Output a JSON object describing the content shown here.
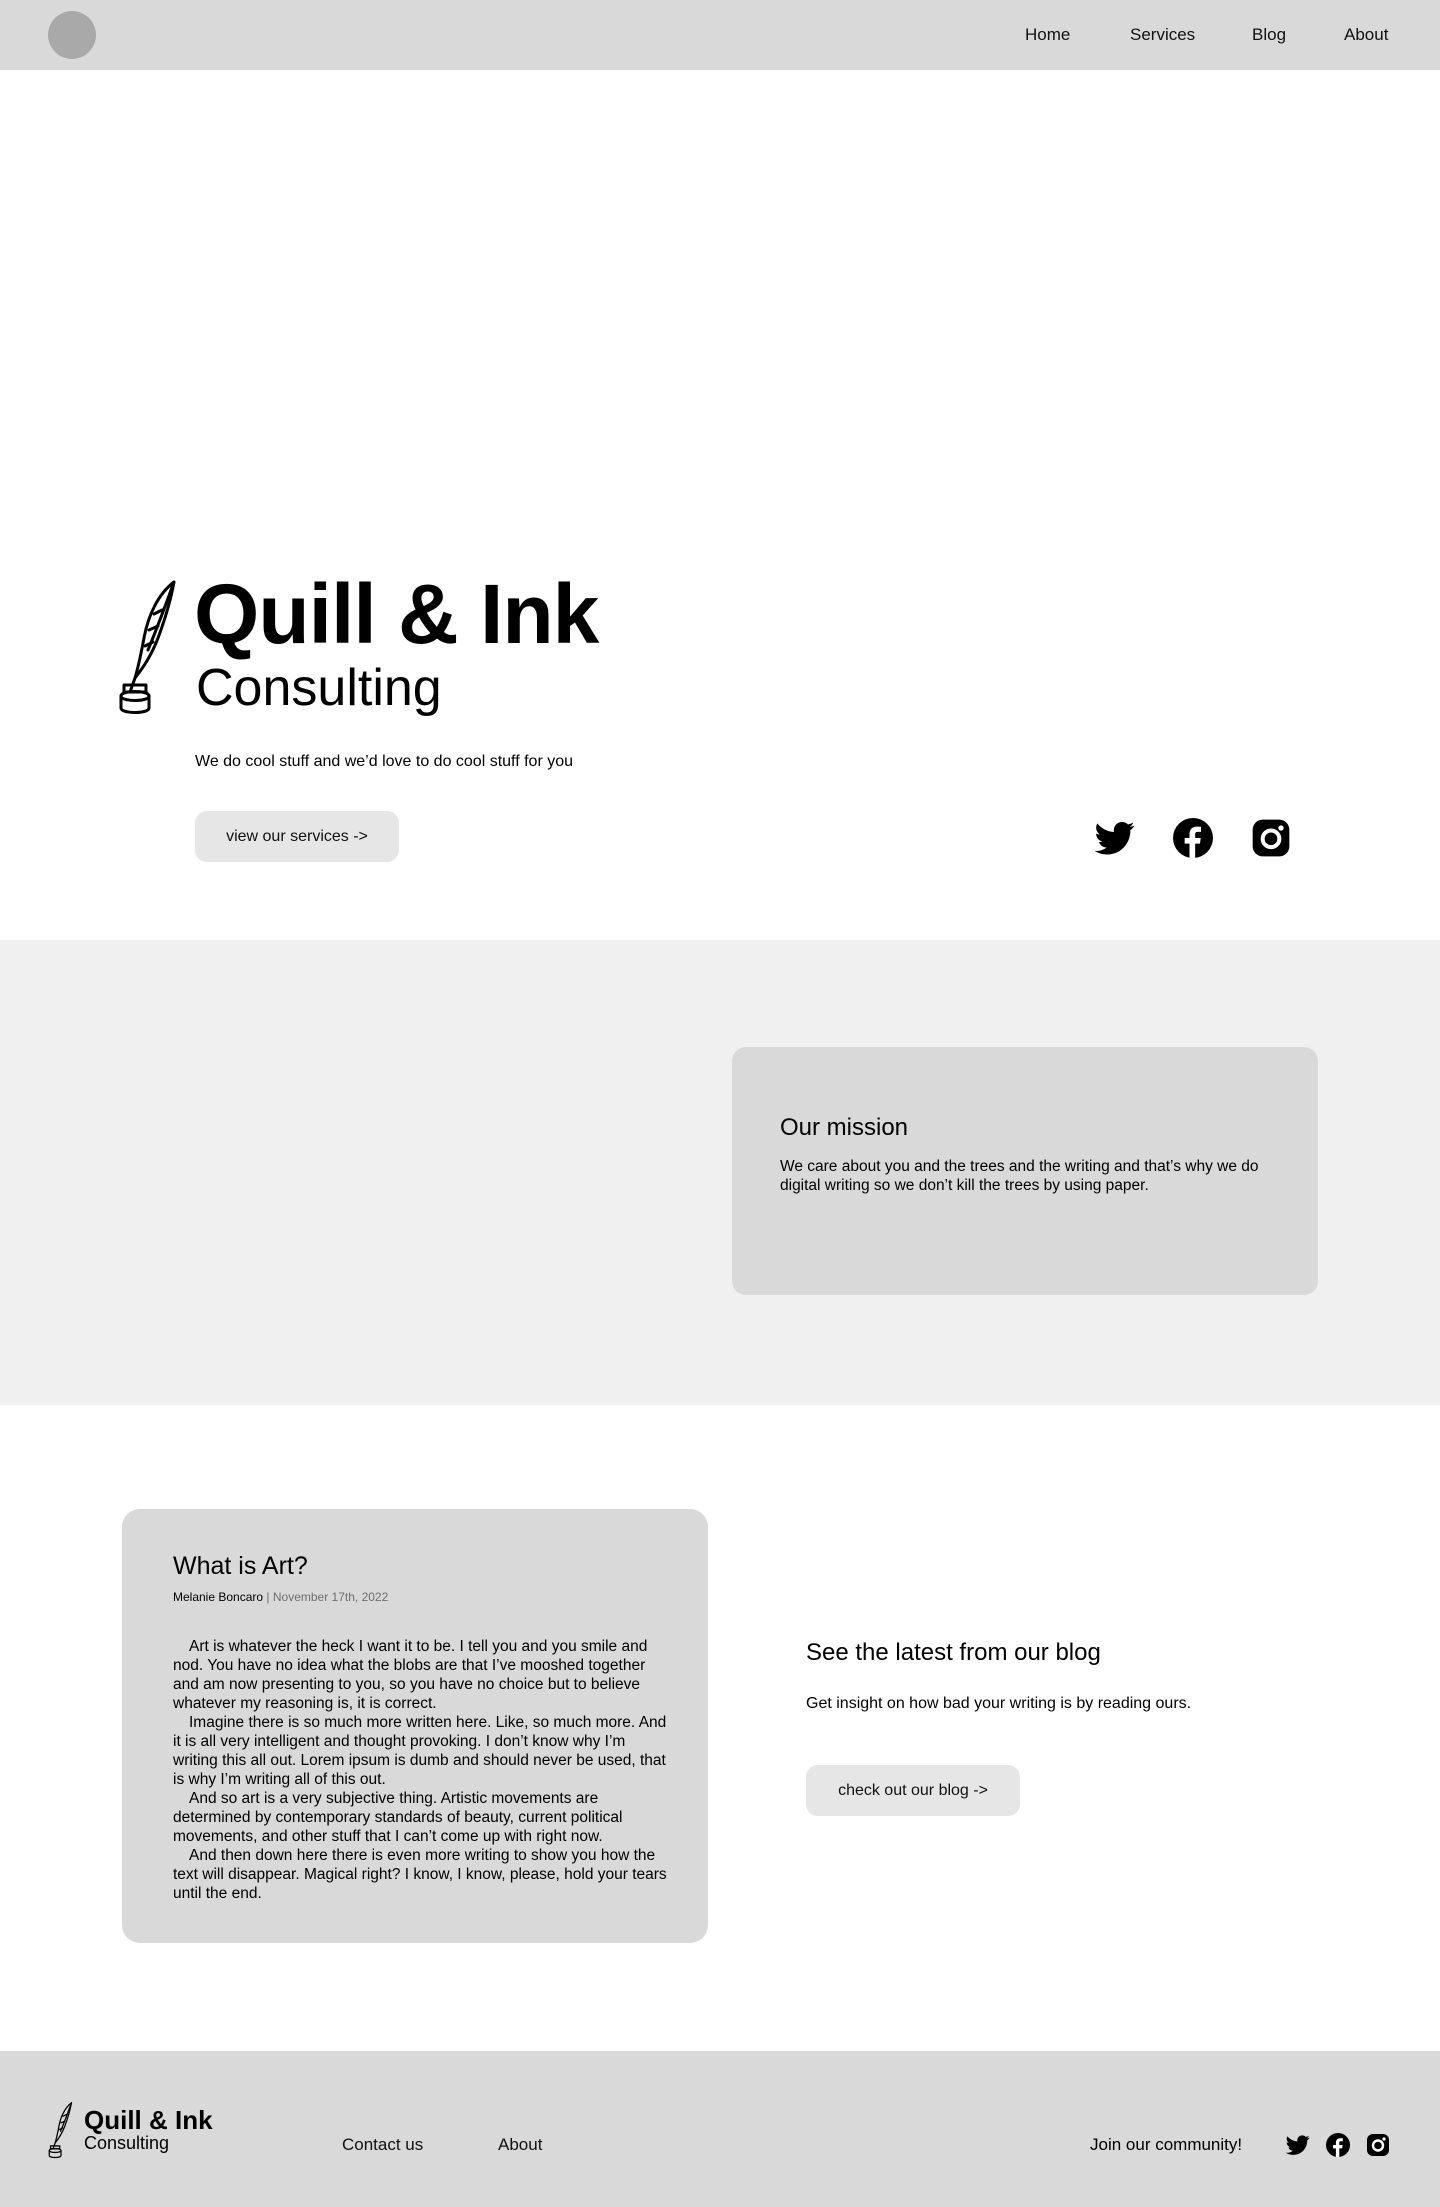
{
  "nav": {
    "links": [
      "Home",
      "Services",
      "Blog",
      "About"
    ]
  },
  "hero": {
    "title": "Quill & Ink",
    "subtitle": "Consulting",
    "tagline": "We do cool stuff and we’d love to do cool stuff for you",
    "cta_label": "view our services ->"
  },
  "social": [
    "twitter-icon",
    "facebook-icon",
    "instagram-icon"
  ],
  "mission": {
    "heading": "Our mission",
    "body": "We care about you and the trees and the writing and that’s why we do digital writing so we don’t kill the trees by using paper."
  },
  "blog_post": {
    "title": "What is Art?",
    "author": "Melanie Boncaro",
    "separator": " | ",
    "date": "November 17th, 2022",
    "paragraphs": [
      "Art is whatever the heck I want it to be. I tell you and you smile and nod. You have no idea what the blobs are that I’ve mooshed together and am now presenting to you, so you have no choice but to believe whatever my reasoning is, it is correct.",
      "Imagine there is so much more written here. Like, so much more. And it is all very intelligent and thought provoking. I don’t know why I’m writing this all out. Lorem ipsum is dumb and should never be used, that is why I’m writing all of this out.",
      "And so art is a very subjective thing. Artistic movements are determined by contemporary standards of beauty, current political movements, and other stuff that I can’t come up with right now.",
      "And then down here there is even more writing to show you how the text will disappear. Magical right? I know, I know, please, hold your tears until the end."
    ]
  },
  "blog_promo": {
    "heading": "See the latest from our blog",
    "description": "Get insight on how bad your writing is by reading ours.",
    "cta_label": "check out our blog ->"
  },
  "footer": {
    "brand": "Quill & Ink",
    "subtitle": "Consulting",
    "links": [
      "Contact us",
      "About"
    ],
    "join_text": "Join our community!"
  },
  "colors": {
    "nav_bg": "#d9d9d9",
    "logo_circle": "#a9a9a9",
    "mission_band": "#f0f0f0",
    "card_bg": "#d9d9d9",
    "button_bg": "#e6e6e6",
    "footer_bg": "#d9d9d9"
  }
}
